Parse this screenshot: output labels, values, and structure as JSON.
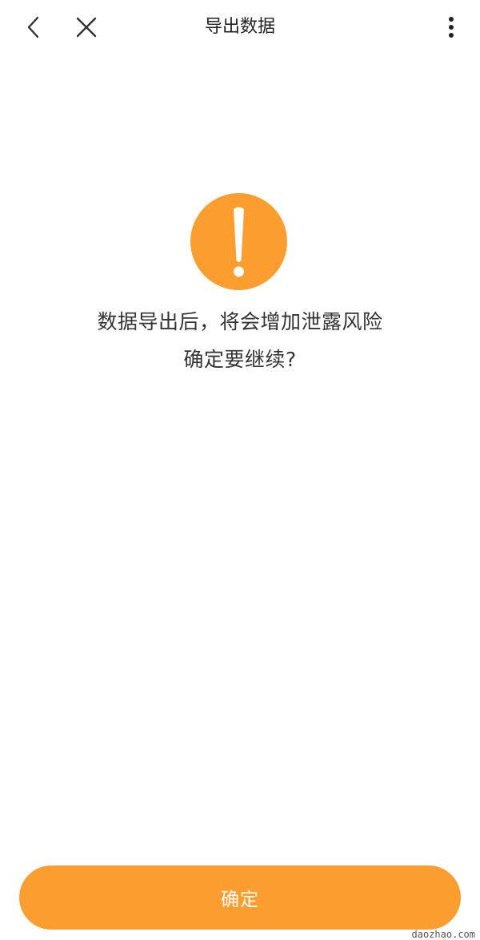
{
  "header": {
    "title": "导出数据",
    "back_icon": "back-arrow-icon",
    "close_icon": "close-icon",
    "more_icon": "more-vertical-icon"
  },
  "warning": {
    "icon": "exclamation-circle-icon",
    "icon_color": "#fb9d2f",
    "line1": "数据导出后，将会增加泄露风险",
    "line2": "确定要继续?"
  },
  "footer": {
    "confirm_label": "确定",
    "button_color": "#fb9d2f"
  },
  "watermark": {
    "text": "daozhao.com"
  }
}
